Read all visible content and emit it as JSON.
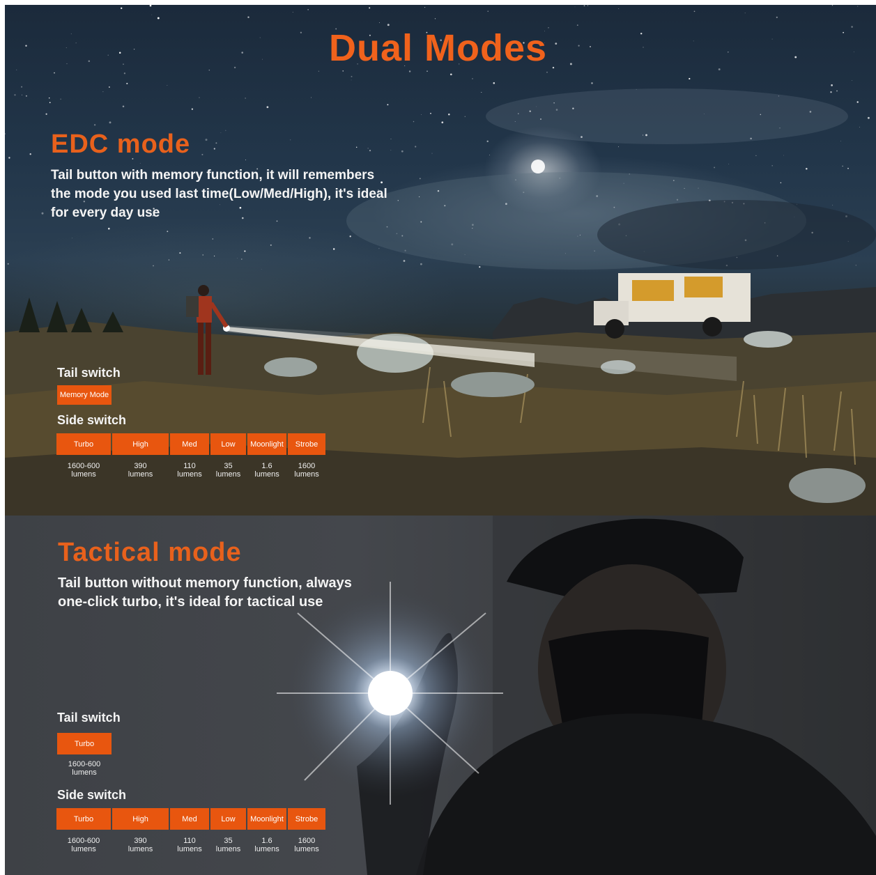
{
  "title": "Dual Modes",
  "edc": {
    "title": "EDC mode",
    "desc_lines": [
      "Tail button with memory function, it will remembers",
      "the mode you used last time(Low/Med/High), it's ideal",
      "for every day use"
    ],
    "tail_label": "Tail switch",
    "tail_button": "Memory Mode",
    "side_label": "Side switch",
    "side_buttons": [
      {
        "label": "Turbo",
        "value": "1600-600",
        "unit": "lumens"
      },
      {
        "label": "High",
        "value": "390",
        "unit": "lumens"
      },
      {
        "label": "Med",
        "value": "110",
        "unit": "lumens"
      },
      {
        "label": "Low",
        "value": "35",
        "unit": "lumens"
      },
      {
        "label": "Moonlight",
        "value": "1.6",
        "unit": "lumens"
      },
      {
        "label": "Strobe",
        "value": "1600",
        "unit": "lumens"
      }
    ]
  },
  "tactical": {
    "title": "Tactical mode",
    "desc_lines": [
      "Tail button without memory function, always",
      "one-click turbo, it's ideal for tactical use"
    ],
    "tail_label": "Tail switch",
    "tail_button": "Turbo",
    "tail_value": "1600-600",
    "tail_unit": "lumens",
    "side_label": "Side switch",
    "side_buttons": [
      {
        "label": "Turbo",
        "value": "1600-600",
        "unit": "lumens"
      },
      {
        "label": "High",
        "value": "390",
        "unit": "lumens"
      },
      {
        "label": "Med",
        "value": "110",
        "unit": "lumens"
      },
      {
        "label": "Low",
        "value": "35",
        "unit": "lumens"
      },
      {
        "label": "Moonlight",
        "value": "1.6",
        "unit": "lumens"
      },
      {
        "label": "Strobe",
        "value": "1600",
        "unit": "lumens"
      }
    ]
  },
  "colors": {
    "accent": "#e8560f",
    "title": "#f0621c"
  }
}
